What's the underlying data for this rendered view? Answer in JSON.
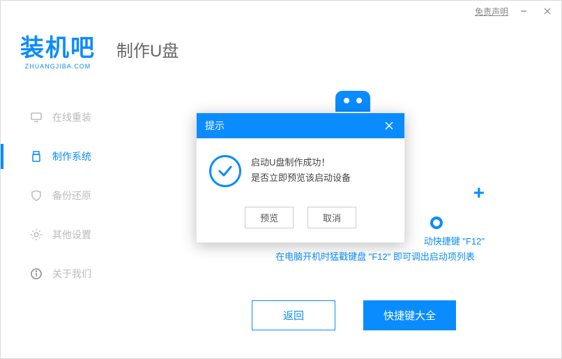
{
  "titlebar": {
    "disclaimer": "免责声明"
  },
  "logo": {
    "main": "装机吧",
    "sub": "ZHUANGJIBA.COM"
  },
  "page_title": "制作U盘",
  "sidebar": {
    "items": [
      {
        "label": "在线重装"
      },
      {
        "label": "制作系统"
      },
      {
        "label": "备份还原"
      },
      {
        "label": "其他设置"
      },
      {
        "label": "关于我们"
      }
    ]
  },
  "hints": {
    "line1_right": "动快捷键 \"F12\"",
    "line2": "在电脑开机时猛戳键盘 \"F12\" 即可调出启动项列表"
  },
  "footer": {
    "back": "返回",
    "shortcut_list": "快捷键大全"
  },
  "dialog": {
    "title": "提示",
    "line1": "启动U盘制作成功！",
    "line2": "是否立即预览该启动设备",
    "preview": "预览",
    "cancel": "取消"
  }
}
